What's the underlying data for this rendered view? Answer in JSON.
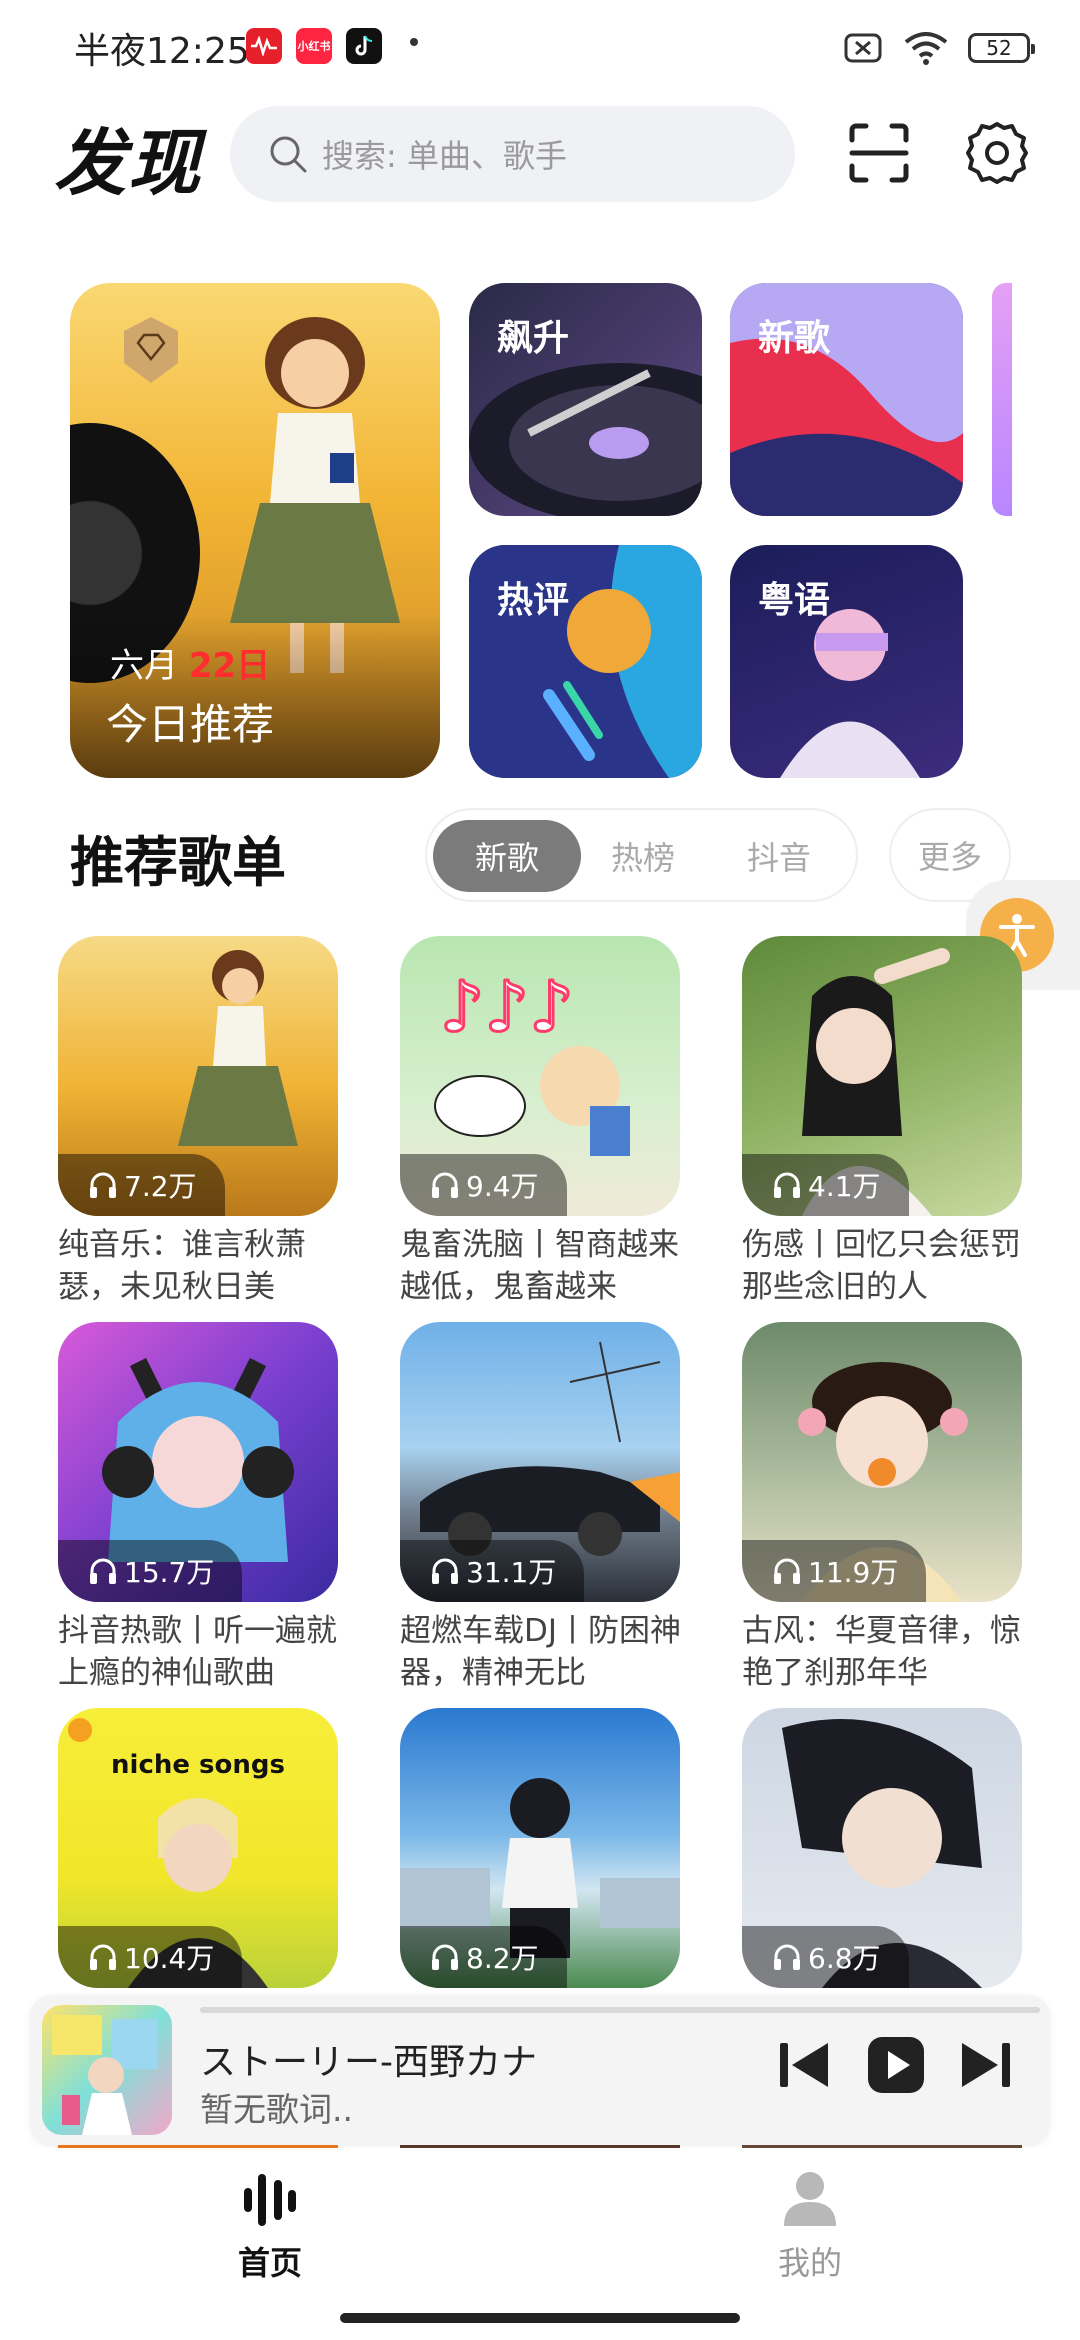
{
  "status_bar": {
    "time": "半夜12:25",
    "app_icons": [
      {
        "name": "netease-music-icon",
        "color": "#e6202a"
      },
      {
        "name": "xiaohongshu-icon",
        "label": "小红书",
        "color": "#ff2442"
      },
      {
        "name": "tiktok-icon",
        "color": "#111111"
      }
    ],
    "battery": "52"
  },
  "header": {
    "title": "发现",
    "search_placeholder": "搜索: 单曲、歌手"
  },
  "top_cards": {
    "daily": {
      "month": "六月",
      "day": "22日",
      "label": "今日推荐"
    },
    "cards": [
      {
        "label": "飙升"
      },
      {
        "label": "新歌"
      },
      {
        "label": "热评"
      },
      {
        "label": "粤语"
      }
    ]
  },
  "section": {
    "title": "推荐歌单",
    "tabs": [
      "新歌",
      "热榜",
      "抖音"
    ],
    "active_tab": "新歌",
    "more": "更多"
  },
  "playlists": [
    {
      "count": "7.2万",
      "title": "纯音乐：谁言秋萧瑟，未见秋日美"
    },
    {
      "count": "9.4万",
      "title": "鬼畜洗脑丨智商越来越低，鬼畜越来"
    },
    {
      "count": "4.1万",
      "title": "伤感丨回忆只会惩罚那些念旧的人"
    },
    {
      "count": "15.7万",
      "title": "抖音热歌丨听一遍就上瘾的神仙歌曲"
    },
    {
      "count": "31.1万",
      "title": "超燃车载DJ丨防困神器，精神无比"
    },
    {
      "count": "11.9万",
      "title": "古风：华夏音律，惊艳了刹那年华"
    },
    {
      "count": "10.4万",
      "title": "",
      "cover_text": "niche songs"
    },
    {
      "count": "8.2万",
      "title": ""
    },
    {
      "count": "6.8万",
      "title": ""
    }
  ],
  "player": {
    "song": "ストーリー-西野カナ",
    "lyric": "暂无歌词.."
  },
  "tabbar": {
    "home": "首页",
    "mine": "我的"
  }
}
